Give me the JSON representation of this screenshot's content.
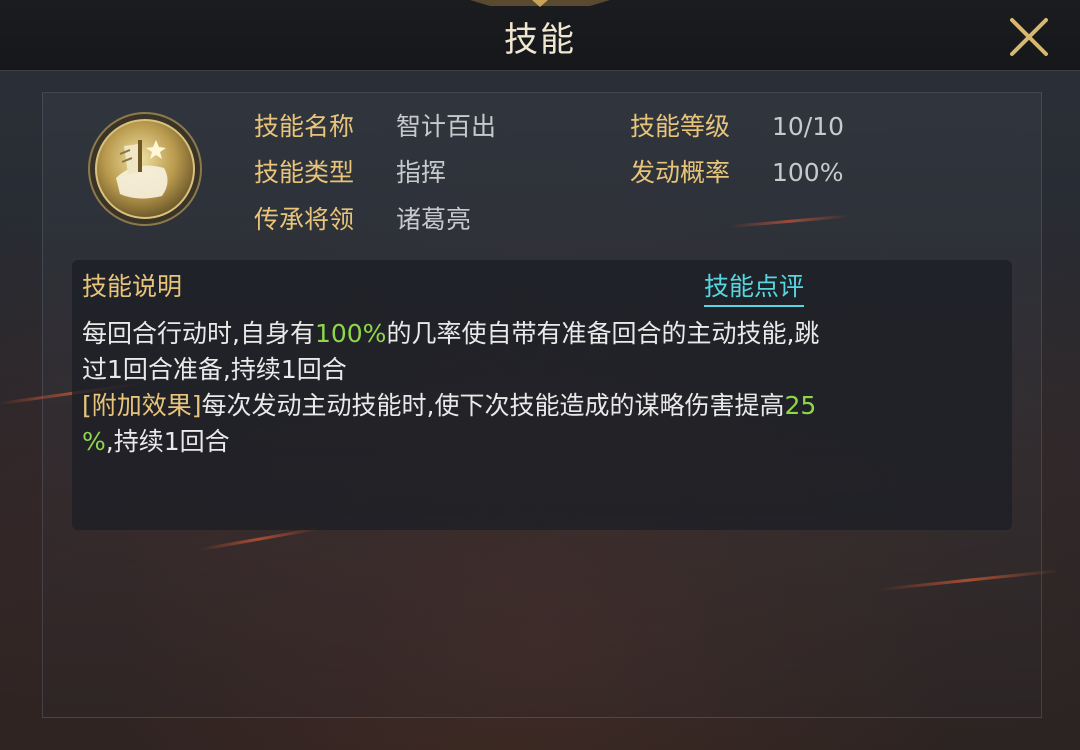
{
  "header": {
    "title": "技能"
  },
  "skill": {
    "icon": "banner-fan-skill-icon",
    "labels": {
      "name": "技能名称",
      "type": "技能类型",
      "heir": "传承将领",
      "level": "技能等级",
      "rate": "发动概率"
    },
    "values": {
      "name": "智计百出",
      "type": "指挥",
      "heir": "诸葛亮",
      "level": "10/10",
      "rate": "100%"
    }
  },
  "description": {
    "title": "技能说明",
    "review_link": "技能点评",
    "line1_a": "每回合行动时,自身有",
    "line1_pct": "100%",
    "line1_b": "的几率使自带有准备回合的主动技能,跳",
    "line2": "过1回合准备,持续1回合",
    "extra_tag": "[附加效果]",
    "extra_a": "每次发动主动技能时,使下次技能造成的谋略伤害提高",
    "extra_pct1": "25",
    "extra_pct2": "%",
    "extra_b": ",持续1回合"
  },
  "colors": {
    "label_gold": "#e8c47a",
    "value_grey": "#c7c9cd",
    "highlight_green": "#8ed64a",
    "link_cyan": "#56d7e0"
  }
}
